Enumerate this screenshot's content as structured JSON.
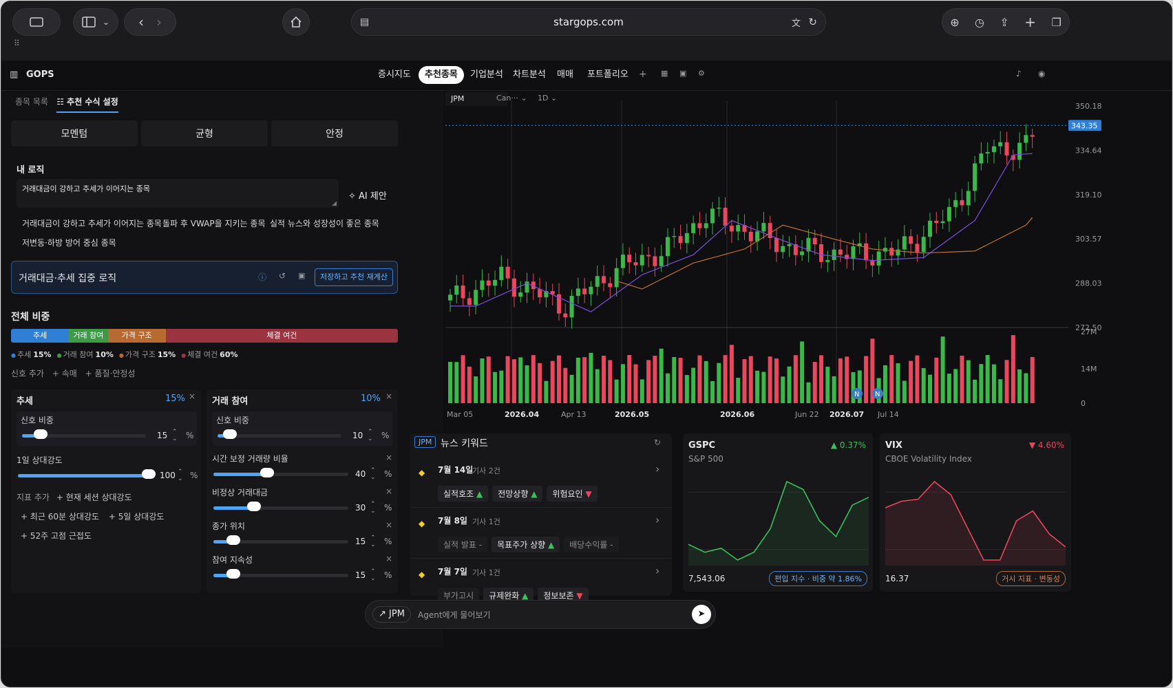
{
  "browser": {
    "url": "stargops.com"
  },
  "app": {
    "name": "GOPS",
    "nav": [
      "증시지도",
      "추천종목",
      "기업분석",
      "차트분석",
      "매매",
      "포트폴리오"
    ],
    "active_nav": "추천종목"
  },
  "left": {
    "tabs": [
      "종목 목록",
      "추천 수식 설정"
    ],
    "presets": [
      "모멘텀",
      "균형",
      "안정"
    ],
    "my_logic_title": "내 로직",
    "logic_text": "거래대금이 강하고 추세가 이어지는 종목",
    "ai_suggest": "AI 제안",
    "suggestions": [
      "거래대금이 강하고 추세가 이어지는 종목",
      "돌파 후 VWAP을 지키는 종목",
      "실적 뉴스와 성장성이 좋은 종목",
      "저변동·하방 방어 중심 종목"
    ],
    "formula_name": "거래대금·추세 집중 로직",
    "save_button": "저장하고 추천 재계산",
    "weights_title": "전체 비중",
    "weights": [
      {
        "name": "추세",
        "value": 15,
        "color": "#2f7fd6",
        "label": "15%"
      },
      {
        "name": "거래 참여",
        "value": 10,
        "color": "#3f9a48",
        "label": "10%"
      },
      {
        "name": "가격 구조",
        "value": 15,
        "color": "#b86a33",
        "label": "15%"
      },
      {
        "name": "체결 여건",
        "value": 60,
        "color": "#9c3341",
        "label": "60%"
      }
    ],
    "add_signal": "신호 추가",
    "add_options": [
      "속매",
      "품질·안정성"
    ],
    "cards": [
      {
        "title": "추세",
        "pct": "15%",
        "signal_label": "신호 비중",
        "signal_value": "15",
        "signal_fraction": 0.15,
        "items": [
          {
            "name": "1일 상대강도",
            "value": "100",
            "fraction": 1.0
          }
        ],
        "add_label": "지표 추가",
        "add_items": [
          "현재 세션 상대강도",
          "최근 60분 상대강도",
          "5일 상대강도",
          "52주 고점 근접도"
        ]
      },
      {
        "title": "거래 참여",
        "pct": "10%",
        "signal_label": "신호 비중",
        "signal_value": "10",
        "signal_fraction": 0.1,
        "items": [
          {
            "name": "시간 보정 거래량 비율",
            "value": "40",
            "fraction": 0.4
          },
          {
            "name": "비정상 거래대금",
            "value": "30",
            "fraction": 0.3
          },
          {
            "name": "종가 위치",
            "value": "15",
            "fraction": 0.15
          },
          {
            "name": "참여 지속성",
            "value": "15",
            "fraction": 0.15
          }
        ]
      }
    ],
    "unit": "%"
  },
  "chart": {
    "symbol": "JPM",
    "type_label": "Can···",
    "interval": "1D",
    "price_ticks": [
      "350.18",
      "334.64",
      "319.10",
      "303.57",
      "288.03",
      "272.50"
    ],
    "current_price": "343.35",
    "volume_ticks": [
      "27M",
      "14M",
      "0"
    ],
    "x_labels": [
      "Mar 05",
      "2026.04",
      "Apr 13",
      "2026.05",
      "2026.06",
      "Jun 22",
      "2026.07",
      "Jul 14"
    ],
    "colors": {
      "up": "#3ab84a",
      "down": "#e8475e",
      "ma1": "#7b4fe0",
      "ma2": "#c07030"
    }
  },
  "news": {
    "badge": "JPM",
    "title": "뉴스 키워드",
    "entries": [
      {
        "date": "7월 14일",
        "count": "기사 2건",
        "chips": [
          {
            "t": "실적호조",
            "dir": "up"
          },
          {
            "t": "전망상향",
            "dir": "up"
          },
          {
            "t": "위험요인",
            "dir": "down"
          }
        ]
      },
      {
        "date": "7월 8일",
        "count": "기사 1건",
        "chips": [
          {
            "t": "실적 발표 -",
            "dir": "none"
          },
          {
            "t": "목표주가 상향",
            "dir": "up"
          },
          {
            "t": "배당수익률 -",
            "dir": "none"
          }
        ]
      },
      {
        "date": "7월 7일",
        "count": "기사 1건",
        "chips": [
          {
            "t": "부가고시",
            "dir": "none"
          },
          {
            "t": "규제완화",
            "dir": "up"
          },
          {
            "t": "정보보존",
            "dir": "down"
          }
        ]
      }
    ]
  },
  "gspc": {
    "symbol": "GSPC",
    "name": "S&P 500",
    "change": "0.37%",
    "value": "7,543.06",
    "badge": "편입 지수 · 비중 약 1.86%",
    "series": [
      5,
      4,
      4.5,
      3,
      4,
      7,
      13,
      12,
      8,
      6,
      10,
      11
    ]
  },
  "vix": {
    "symbol": "VIX",
    "name": "CBOE Volatility Index",
    "change": "4.60%",
    "value": "16.37",
    "badge": "거시 지표 · 변동성",
    "series": [
      8,
      9,
      9.3,
      12,
      10,
      5,
      0,
      0,
      6,
      7.5,
      4,
      2
    ]
  },
  "agent": {
    "symbol": "JPM",
    "placeholder": "Agent에게 물어보기"
  }
}
